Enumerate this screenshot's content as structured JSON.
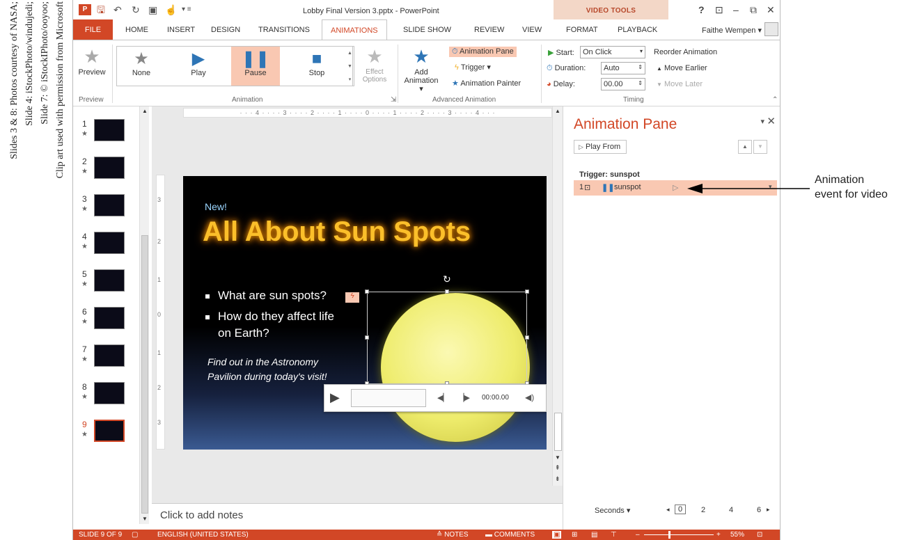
{
  "credits": [
    "Slides 3 & 8: Photos courtesy of NASA;",
    "Slide 4: iStockPhoto/windujedi;",
    "Slide 7: © iStockIPhoto/ooyoo;",
    "Clip art used with permission from Microsoft"
  ],
  "titlebar": {
    "doc_title": "Lobby Final Version 3.pptx - PowerPoint",
    "video_tools": "VIDEO TOOLS",
    "help": "?",
    "restore_ribbon": "⊡",
    "minimize": "–",
    "maximize": "⧉",
    "close": "✕"
  },
  "tabs": {
    "file": "FILE",
    "home": "HOME",
    "insert": "INSERT",
    "design": "DESIGN",
    "transitions": "TRANSITIONS",
    "animations": "ANIMATIONS",
    "slide_show": "SLIDE SHOW",
    "review": "REVIEW",
    "view": "VIEW",
    "format": "FORMAT",
    "playback": "PLAYBACK",
    "user": "Faithe Wempen ▾"
  },
  "ribbon": {
    "preview": {
      "button": "Preview",
      "group": "Preview"
    },
    "animation": {
      "group": "Animation",
      "items": [
        "None",
        "Play",
        "Pause",
        "Stop"
      ],
      "selected": "Pause",
      "effect_options": "Effect\nOptions"
    },
    "advanced": {
      "group": "Advanced Animation",
      "add_animation": "Add\nAnimation ▾",
      "animation_pane": "Animation Pane",
      "trigger": "Trigger ▾",
      "animation_painter": "Animation Painter"
    },
    "timing": {
      "group": "Timing",
      "start_label": "Start:",
      "start_value": "On Click",
      "duration_label": "Duration:",
      "duration_value": "Auto",
      "delay_label": "Delay:",
      "delay_value": "00.00",
      "reorder": "Reorder Animation",
      "move_earlier": "Move Earlier",
      "move_later": "Move Later"
    }
  },
  "thumbnails": [
    {
      "num": "1",
      "star": "★"
    },
    {
      "num": "2",
      "star": "★"
    },
    {
      "num": "3",
      "star": "★"
    },
    {
      "num": "4",
      "star": "★"
    },
    {
      "num": "5",
      "star": "★"
    },
    {
      "num": "6",
      "star": "★"
    },
    {
      "num": "7",
      "star": "★"
    },
    {
      "num": "8",
      "star": "★"
    },
    {
      "num": "9",
      "star": "★"
    }
  ],
  "active_slide": 9,
  "ruler": {
    "horizontal": "· · · 4 · · · · 3 · · · · 2 · · · · 1 · · · · 0 · · · · 1 · · · · 2 · · · · 3 · · · · 4 · · ·",
    "vertical": [
      "3",
      "2",
      "1",
      "0",
      "1",
      "2",
      "3"
    ]
  },
  "slide": {
    "kicker": "New!",
    "title": "All About Sun Spots",
    "bullet1": "What are sun spots?",
    "trigger_tag": "ϟ",
    "bullet2_line1": "How do they affect life",
    "bullet2_line2": "on Earth?",
    "tagline_line1": "Find out in the Astronomy",
    "tagline_line2": "Pavilion during today's visit!",
    "video_time": "00:00.00"
  },
  "notes_placeholder": "Click to add notes",
  "anim_pane": {
    "title": "Animation Pane",
    "play_from": "Play From",
    "trigger_label": "Trigger: sunspot",
    "item_number": "1",
    "item_name": "sunspot",
    "seconds": "Seconds ▾",
    "timeline": [
      "0",
      "2",
      "4",
      "6"
    ]
  },
  "statusbar": {
    "slide_count": "SLIDE 9 OF 9",
    "language": "ENGLISH (UNITED STATES)",
    "notes": "≙ NOTES",
    "comments": "COMMENTS",
    "zoom": "55%"
  },
  "callout": {
    "line1": "Animation",
    "line2": "event for video"
  },
  "colors": {
    "accent": "#d24726",
    "highlight": "#f9c8b2",
    "slide_title": "#fbbf2a"
  }
}
